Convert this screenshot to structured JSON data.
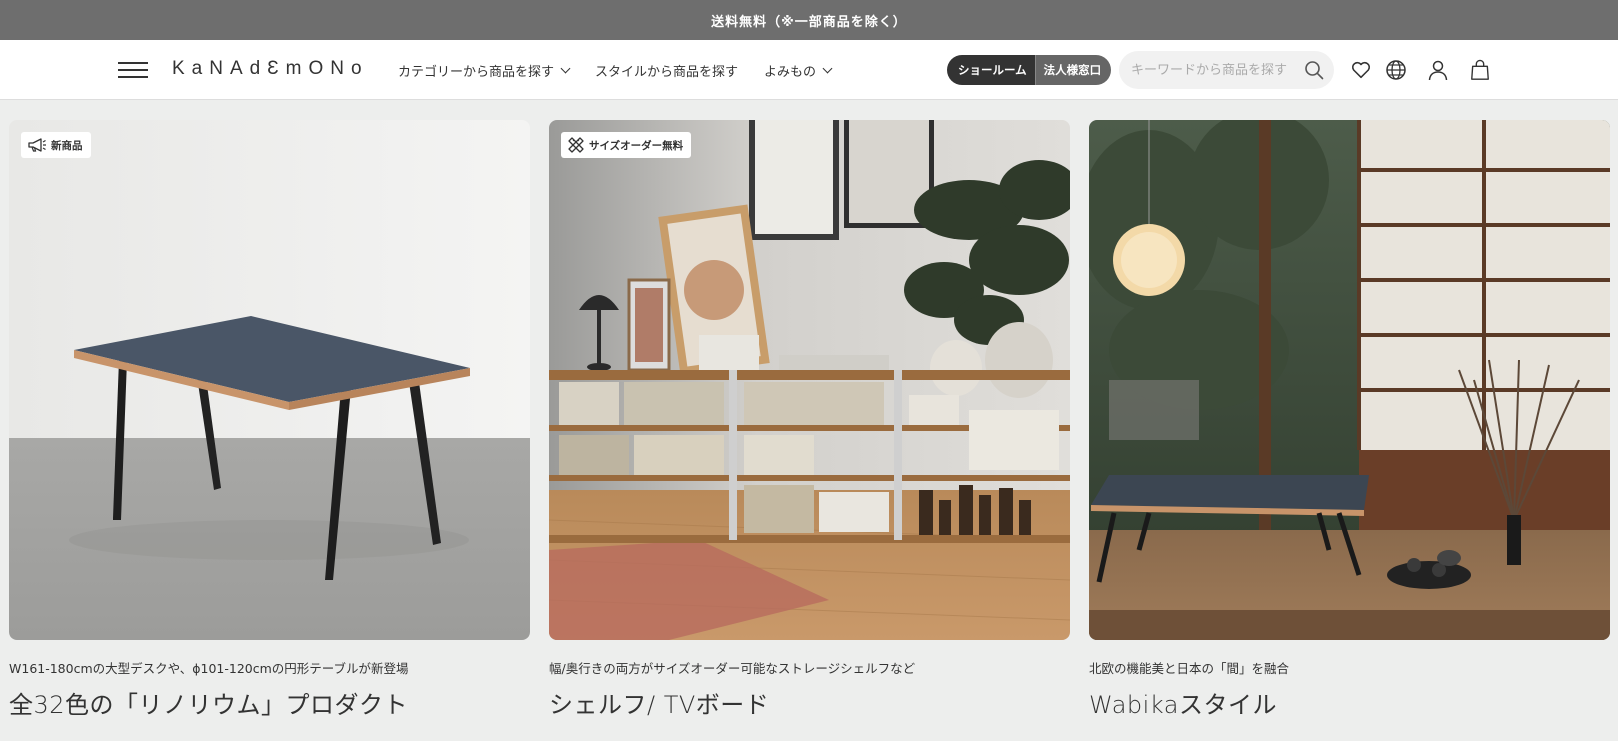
{
  "announcement": "送料無料（※一部商品を除く）",
  "header": {
    "logo": "KaNAdƐmONo",
    "nav": [
      {
        "label": "カテゴリーから商品を探す",
        "has_dropdown": true
      },
      {
        "label": "スタイルから商品を探す",
        "has_dropdown": false
      },
      {
        "label": "よみもの",
        "has_dropdown": true
      }
    ],
    "showroom_label": "ショールーム",
    "corporate_label": "法人様窓口",
    "search_placeholder": "キーワードから商品を探す",
    "icons": [
      "heart-icon",
      "globe-icon",
      "user-icon",
      "cart-icon"
    ]
  },
  "cards": [
    {
      "badge": "新商品",
      "badge_icon": "megaphone-icon",
      "subtitle": "W161-180cmの大型デスクや、ϕ101-120cmの円形テーブルが新登場",
      "title": "全32色の「リノリウム」プロダクト"
    },
    {
      "badge": "サイズオーダー無料",
      "badge_icon": "ruler-icon",
      "subtitle": "幅/奥行きの両方がサイズオーダー可能なストレージシェルフなど",
      "title": "シェルフ/ TVボード"
    },
    {
      "badge": "",
      "subtitle": "北欧の機能美と日本の「間」を融合",
      "title": "Wabikaスタイル"
    }
  ],
  "colors": {
    "announcement_bg": "#6e6e6e",
    "page_bg": "#edeeed",
    "showroom_bg": "#333333",
    "corporate_bg": "#666666"
  }
}
